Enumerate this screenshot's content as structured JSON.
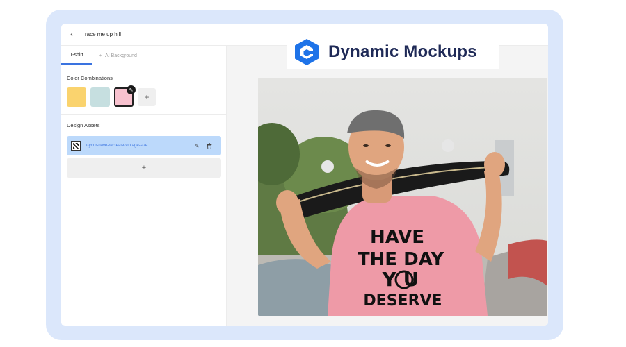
{
  "topbar": {
    "back_icon": "chevron-left-icon",
    "title": "race me up hill"
  },
  "tabs": [
    {
      "label": "T-shirt",
      "active": true
    },
    {
      "label": "AI Background",
      "active": false
    }
  ],
  "color_section": {
    "title": "Color Combinations",
    "swatches": [
      "#fad36e",
      "#c6dfe0",
      "#f8c2cf"
    ],
    "selected_index": 2
  },
  "assets_section": {
    "title": "Design Assets",
    "items": [
      {
        "name": "f-your-have-recreate-vintage-size..."
      }
    ]
  },
  "logo": {
    "text": "Dynamic Mockups",
    "colors": {
      "mark": "#1e73e8",
      "text": "#1f2a57"
    }
  },
  "mockup": {
    "shirt_color": "#ee9aa7",
    "print_lines": [
      "HAVE",
      "THE DAY",
      "Y   U",
      "DESERVE"
    ]
  }
}
